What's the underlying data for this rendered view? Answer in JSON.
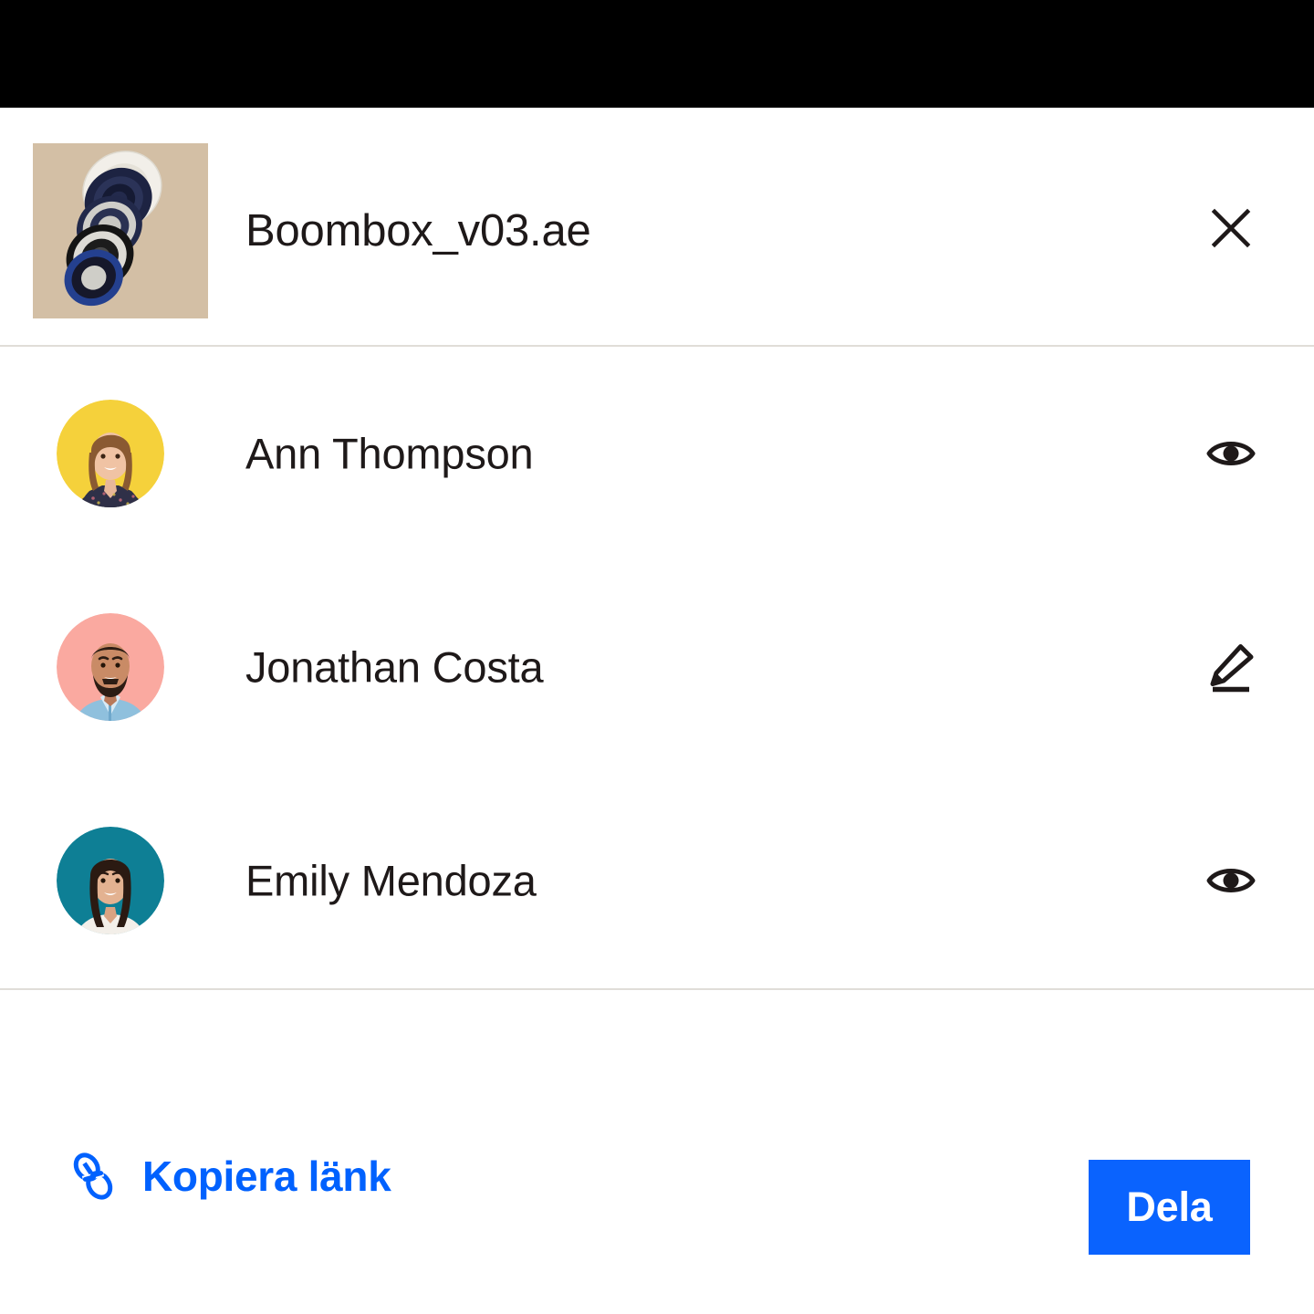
{
  "theme": {
    "accent_blue": "#0061FE",
    "button_blue": "#0A63FE",
    "text_dark": "#1E1919",
    "divider": "#E0DDD8",
    "topband": "#000000",
    "background": "#FFFFFF"
  },
  "header": {
    "file_name": "Boombox_v03.ae",
    "thumbnail_background": "#D3BFA5",
    "thumbnail_alt": "exploded-view speaker render",
    "close_icon": "close-icon"
  },
  "people": [
    {
      "name": "Ann Thompson",
      "avatar_background": "#F5D13B",
      "permission_icon": "eye-icon",
      "permission": "can view"
    },
    {
      "name": "Jonathan Costa",
      "avatar_background": "#FAA9A0",
      "permission_icon": "pencil-icon",
      "permission": "can edit"
    },
    {
      "name": "Emily Mendoza",
      "avatar_background": "#0E7F95",
      "permission_icon": "eye-icon",
      "permission": "can view"
    }
  ],
  "footer": {
    "copy_link_label": "Kopiera länk",
    "copy_link_icon": "link-icon",
    "share_label": "Dela"
  }
}
